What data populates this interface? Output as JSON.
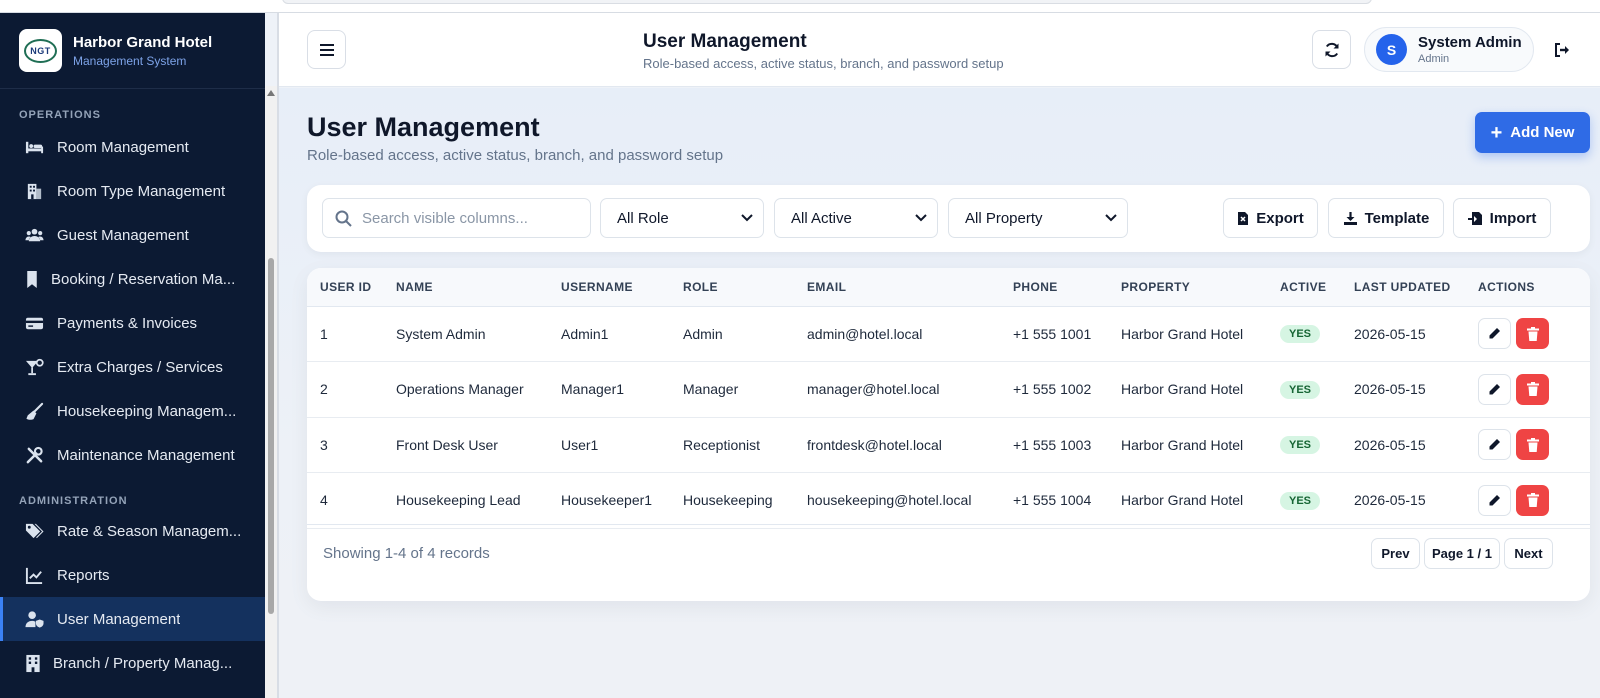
{
  "brand": {
    "title": "Harbor Grand Hotel",
    "subtitle": "Management System",
    "logo_text": "NGT"
  },
  "sidebar": {
    "sections": [
      {
        "label": "OPERATIONS"
      },
      {
        "label": "ADMINISTRATION"
      }
    ],
    "items": [
      {
        "label": "Room Management",
        "icon": "bed-icon"
      },
      {
        "label": "Room Type Management",
        "icon": "building-icon"
      },
      {
        "label": "Guest Management",
        "icon": "users-icon"
      },
      {
        "label": "Booking / Reservation Ma...",
        "icon": "bookmark-icon"
      },
      {
        "label": "Payments & Invoices",
        "icon": "credit-card-icon"
      },
      {
        "label": "Extra Charges / Services",
        "icon": "cocktail-icon"
      },
      {
        "label": "Housekeeping Managem...",
        "icon": "broom-icon"
      },
      {
        "label": "Maintenance Management",
        "icon": "tools-icon"
      },
      {
        "label": "Rate & Season Managem...",
        "icon": "tags-icon"
      },
      {
        "label": "Reports",
        "icon": "chart-line-icon"
      },
      {
        "label": "User Management",
        "icon": "user-shield-icon",
        "active": true
      },
      {
        "label": "Branch / Property Manag...",
        "icon": "city-icon"
      }
    ]
  },
  "header": {
    "title": "User Management",
    "subtitle": "Role-based access, active status, branch, and password setup",
    "user_name": "System Admin",
    "user_role": "Admin",
    "avatar_letter": "S"
  },
  "page": {
    "title": "User Management",
    "subtitle": "Role-based access, active status, branch, and password setup",
    "add_label": "Add New"
  },
  "filters": {
    "search_placeholder": "Search visible columns...",
    "role": "All Role",
    "active": "All Active",
    "property": "All Property",
    "export_label": "Export",
    "template_label": "Template",
    "import_label": "Import"
  },
  "table": {
    "columns": [
      "USER ID",
      "NAME",
      "USERNAME",
      "ROLE",
      "EMAIL",
      "PHONE",
      "PROPERTY",
      "ACTIVE",
      "LAST UPDATED",
      "ACTIONS"
    ],
    "rows": [
      {
        "id": "1",
        "name": "System Admin",
        "username": "Admin1",
        "role": "Admin",
        "email": "admin@hotel.local",
        "phone": "+1 555 1001",
        "property": "Harbor Grand Hotel",
        "active": "YES",
        "updated": "2026-05-15"
      },
      {
        "id": "2",
        "name": "Operations Manager",
        "username": "Manager1",
        "role": "Manager",
        "email": "manager@hotel.local",
        "phone": "+1 555 1002",
        "property": "Harbor Grand Hotel",
        "active": "YES",
        "updated": "2026-05-15"
      },
      {
        "id": "3",
        "name": "Front Desk User",
        "username": "User1",
        "role": "Receptionist",
        "email": "frontdesk@hotel.local",
        "phone": "+1 555 1003",
        "property": "Harbor Grand Hotel",
        "active": "YES",
        "updated": "2026-05-15"
      },
      {
        "id": "4",
        "name": "Housekeeping Lead",
        "username": "Housekeeper1",
        "role": "Housekeeping",
        "email": "housekeeping@hotel.local",
        "phone": "+1 555 1004",
        "property": "Harbor Grand Hotel",
        "active": "YES",
        "updated": "2026-05-15"
      }
    ],
    "showing": "Showing 1-4 of 4 records",
    "prev_label": "Prev",
    "page_label": "Page 1 / 1",
    "next_label": "Next"
  },
  "colors": {
    "sidebar_bg": "#0c1a33",
    "accent": "#2f6be6",
    "danger": "#ef4444",
    "success_bg": "#d6f5e3"
  }
}
